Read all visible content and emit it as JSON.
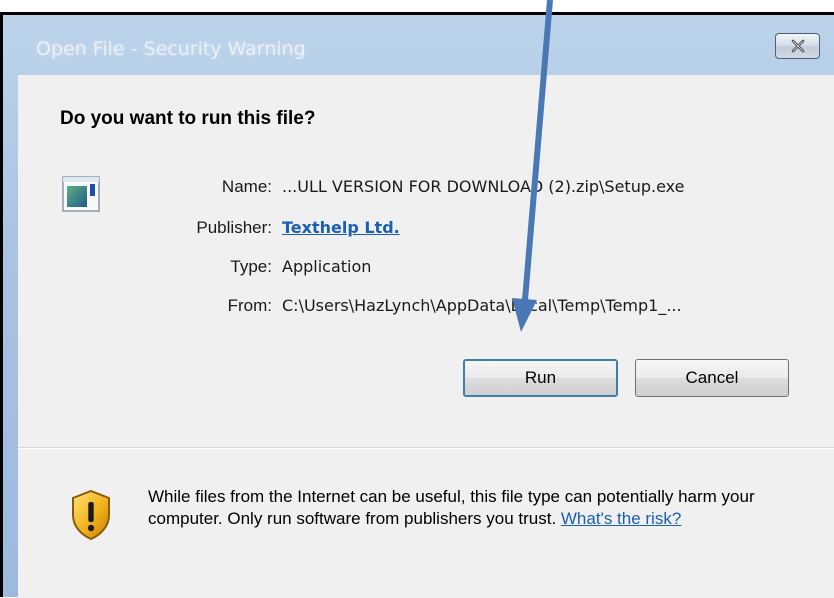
{
  "window": {
    "title": "Open File - Security Warning",
    "close_label": "close"
  },
  "dialog": {
    "question": "Do you want to run this file?",
    "fields": {
      "name_label": "Name:",
      "name_value": "...ULL VERSION FOR DOWNLOAD (2).zip\\Setup.exe",
      "publisher_label": "Publisher:",
      "publisher_value": "Texthelp Ltd.",
      "type_label": "Type:",
      "type_value": "Application",
      "from_label": "From:",
      "from_value": "C:\\Users\\HazLynch\\AppData\\Local\\Temp\\Temp1_..."
    },
    "buttons": {
      "run": "Run",
      "cancel": "Cancel"
    },
    "warning": {
      "text": "While files from the Internet can be useful, this file type can potentially harm your computer. Only run software from publishers you trust. ",
      "risk_link": "What's the risk?"
    }
  },
  "annotation": {
    "arrow_color": "#4a78b5",
    "icon": "arrow-annotation"
  }
}
